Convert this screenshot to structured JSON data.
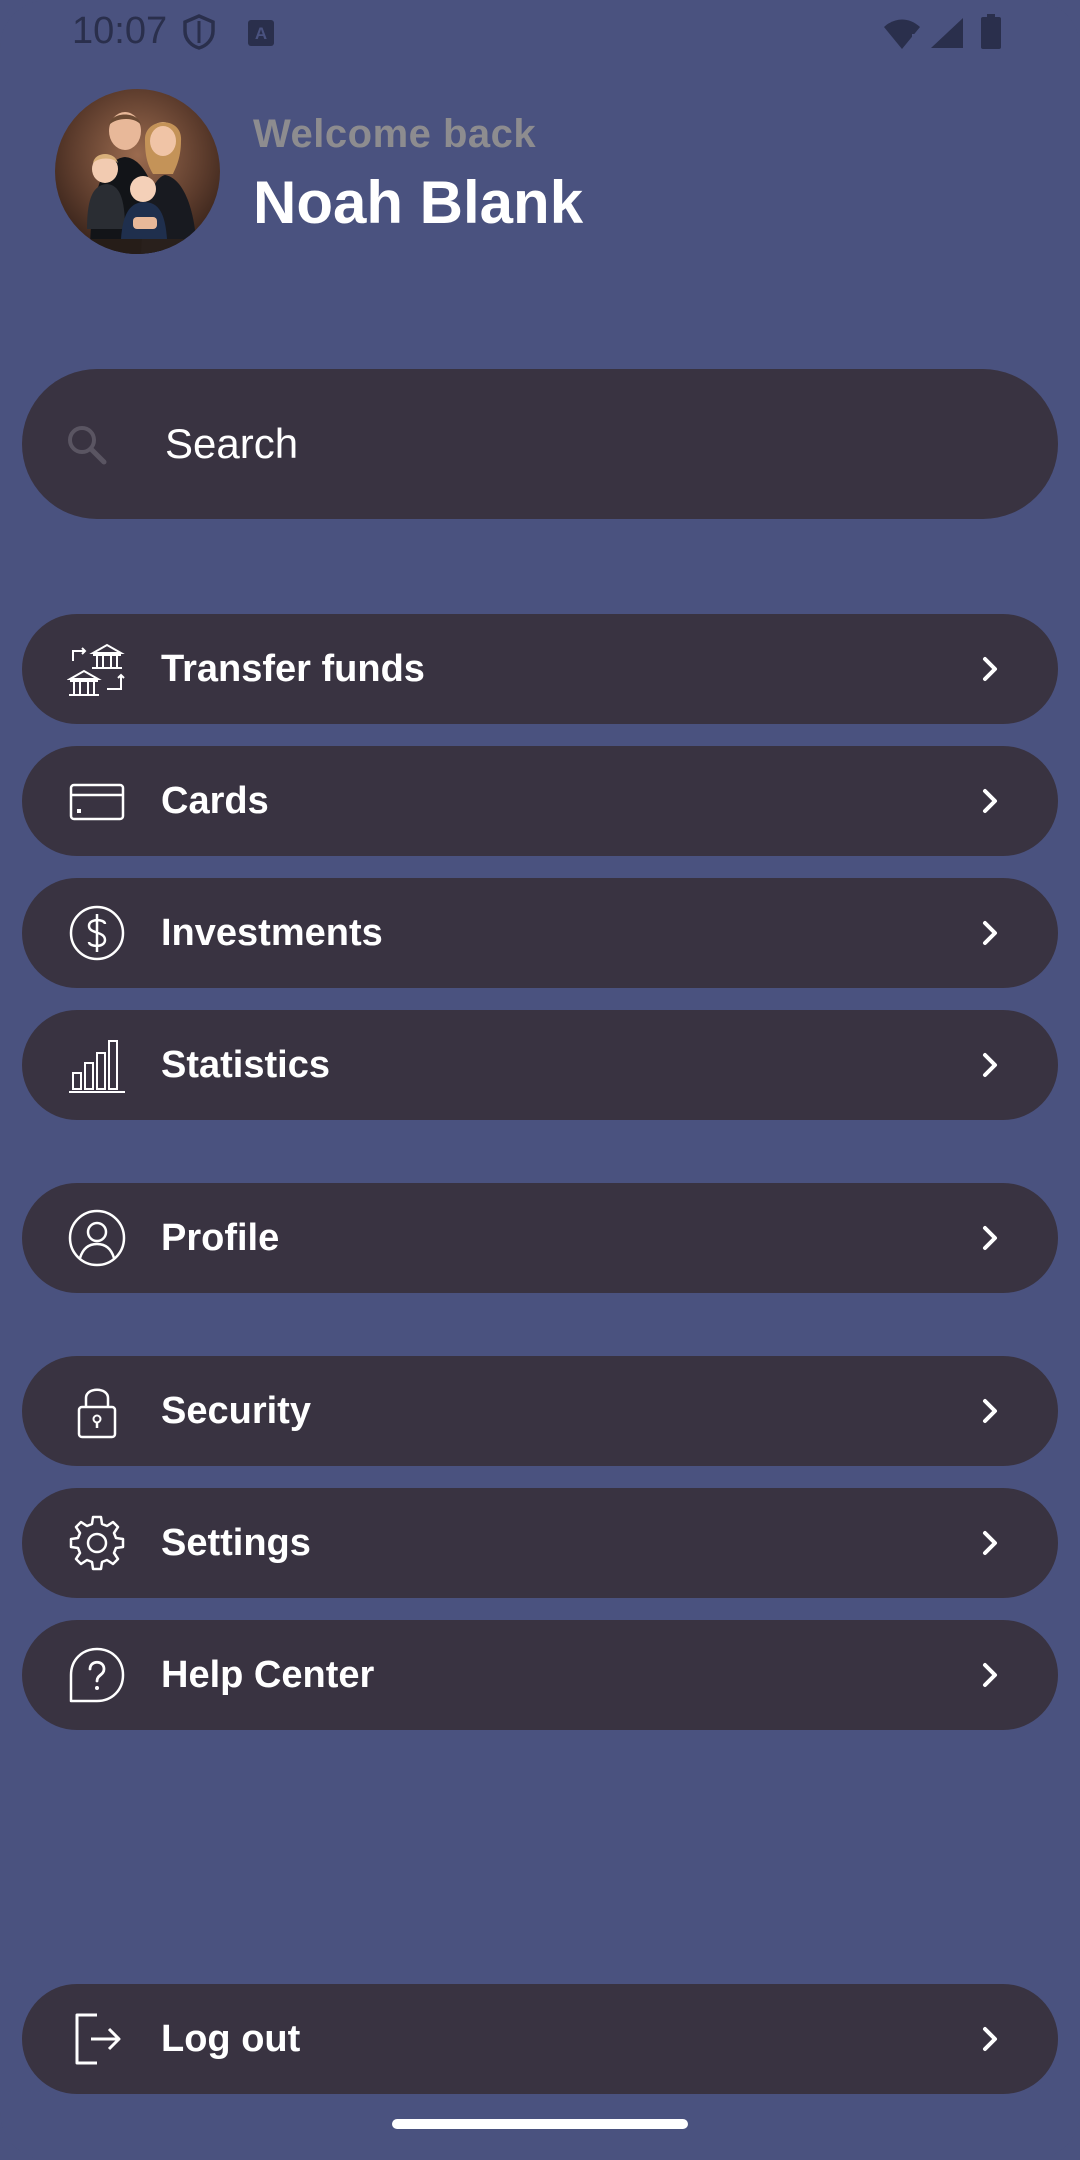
{
  "status_bar": {
    "time": "10:07"
  },
  "header": {
    "welcome_text": "Welcome back",
    "user_name": "Noah Blank"
  },
  "search": {
    "placeholder": "Search"
  },
  "menu": {
    "items": [
      {
        "label": "Transfer funds",
        "icon": "bank-transfer-icon"
      },
      {
        "label": "Cards",
        "icon": "credit-card-icon"
      },
      {
        "label": "Investments",
        "icon": "dollar-circle-icon"
      },
      {
        "label": "Statistics",
        "icon": "bar-chart-icon"
      },
      {
        "label": "Profile",
        "icon": "user-circle-icon"
      },
      {
        "label": "Security",
        "icon": "lock-icon"
      },
      {
        "label": "Settings",
        "icon": "gear-icon"
      },
      {
        "label": "Help Center",
        "icon": "help-bubble-icon"
      }
    ],
    "logout": {
      "label": "Log out",
      "icon": "logout-icon"
    }
  },
  "colors": {
    "background": "#4a527f",
    "card": "#393341",
    "text": "#ffffff",
    "muted_text": "#8d8c8f"
  }
}
